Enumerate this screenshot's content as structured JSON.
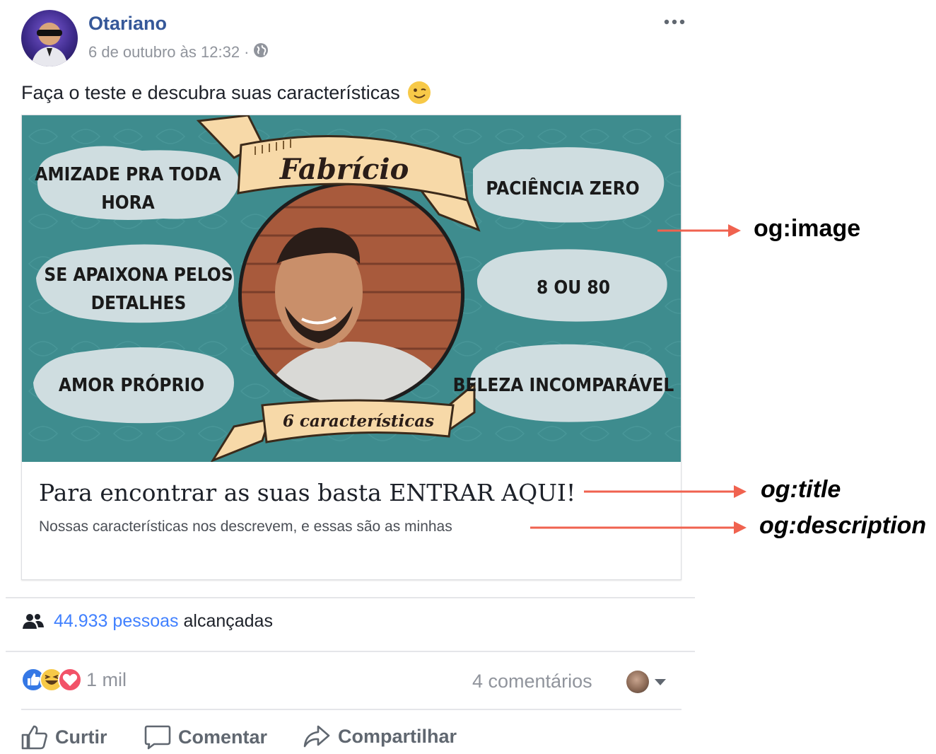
{
  "post": {
    "author": "Otariano",
    "timestamp": "6 de outubro às 12:32",
    "separator": "·",
    "privacy_icon": "globe-icon",
    "more_icon": "more-dots-icon",
    "text": "Faça o teste e descubra suas características",
    "text_emoji": "winking-face-emoji"
  },
  "card": {
    "image": {
      "name_banner": "Fabrício",
      "trait_count_banner": "6 características",
      "traits": [
        "AMIZADE PRA TODA HORA",
        "PACIÊNCIA ZERO",
        "SE APAIXONA PELOS DETALHES",
        "8 OU 80",
        "AMOR PRÓPRIO",
        "BELEZA INCOMPARÁVEL"
      ]
    },
    "title": "Para encontrar as suas basta ENTRAR AQUI!",
    "description": "Nossas características nos descrevem, e essas são as minhas"
  },
  "annotations": {
    "og_image": "og:image",
    "og_title": "og:title",
    "og_description": "og:description",
    "arrow_color": "#f0624f"
  },
  "stats": {
    "reach_icon": "people-icon",
    "reach_count": "44.933 pessoas",
    "reach_suffix": "alcançadas",
    "reactions": [
      "like-reaction-icon",
      "haha-reaction-icon",
      "love-reaction-icon"
    ],
    "reaction_count": "1 mil",
    "comments": "4 comentários",
    "viewer_dropdown_icon": "caret-down-icon"
  },
  "actions": {
    "like": "Curtir",
    "comment": "Comentar",
    "share": "Compartilhar"
  },
  "colors": {
    "link_blue": "#365899",
    "reach_blue": "#4080ff",
    "meta_gray": "#90949c",
    "teal_background": "#3e8c8e",
    "banner": "#f7d9a8",
    "cloud": "#cfdde0"
  }
}
